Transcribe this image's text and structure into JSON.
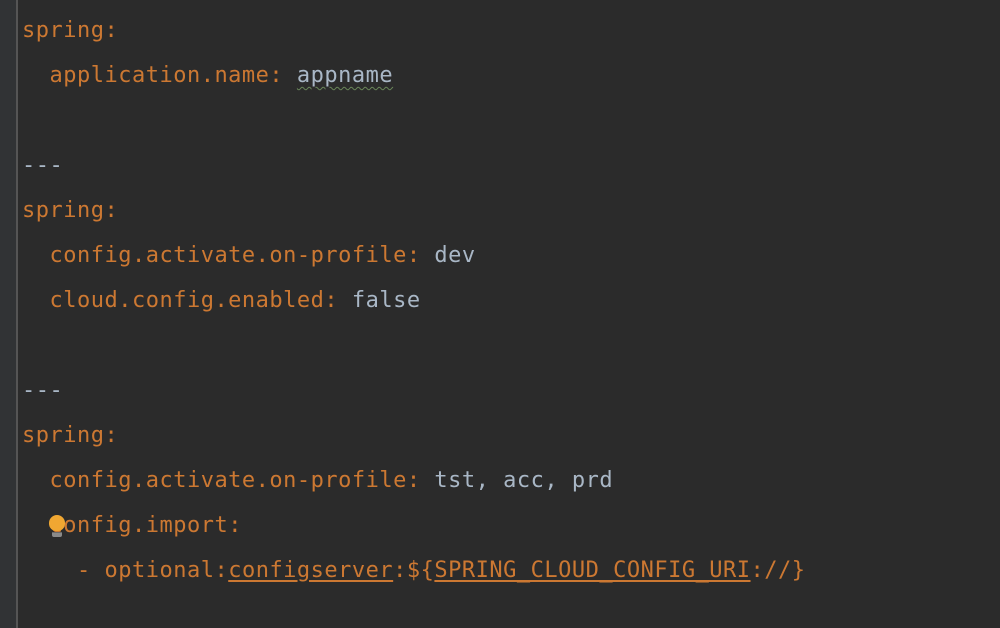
{
  "blocks": [
    {
      "indent": 0,
      "type": "map",
      "key": "spring",
      "colon": ":"
    },
    {
      "indent": 1,
      "type": "kv",
      "key": "application.name",
      "colon": ": ",
      "value": "appname",
      "valueClass": "underline-wavy"
    },
    {
      "indent": 0,
      "type": "blank"
    },
    {
      "indent": 0,
      "type": "sep",
      "text": "---"
    },
    {
      "indent": 0,
      "type": "map",
      "key": "spring",
      "colon": ":"
    },
    {
      "indent": 1,
      "type": "kv",
      "key": "config.activate.on-profile",
      "colon": ": ",
      "value": "dev"
    },
    {
      "indent": 1,
      "type": "kv",
      "key": "cloud.config.enabled",
      "colon": ": ",
      "value": "false"
    },
    {
      "indent": 0,
      "type": "blank"
    },
    {
      "indent": 0,
      "type": "sep",
      "text": "---"
    },
    {
      "indent": 0,
      "type": "map",
      "key": "spring",
      "colon": ":"
    },
    {
      "indent": 1,
      "type": "kv",
      "key": "config.activate.on-profile",
      "colon": ": ",
      "value": "tst, acc, prd"
    },
    {
      "indent": 1,
      "type": "map",
      "key": "config.import",
      "colon": ":",
      "bulb": true
    },
    {
      "indent": 2,
      "type": "listitem",
      "dash": "- ",
      "segments": [
        {
          "t": "optional",
          "c": "key"
        },
        {
          "t": ":",
          "c": "punct"
        },
        {
          "t": "configserver",
          "c": "key underline-link"
        },
        {
          "t": ":",
          "c": "punct"
        },
        {
          "t": "$",
          "c": "key"
        },
        {
          "t": "{",
          "c": "key"
        },
        {
          "t": "SPRING_CLOUD_CONFIG_URI",
          "c": "key underline-link"
        },
        {
          "t": ":",
          "c": "punct"
        },
        {
          "t": "//}",
          "c": "key"
        }
      ]
    }
  ],
  "indentUnit": "  "
}
